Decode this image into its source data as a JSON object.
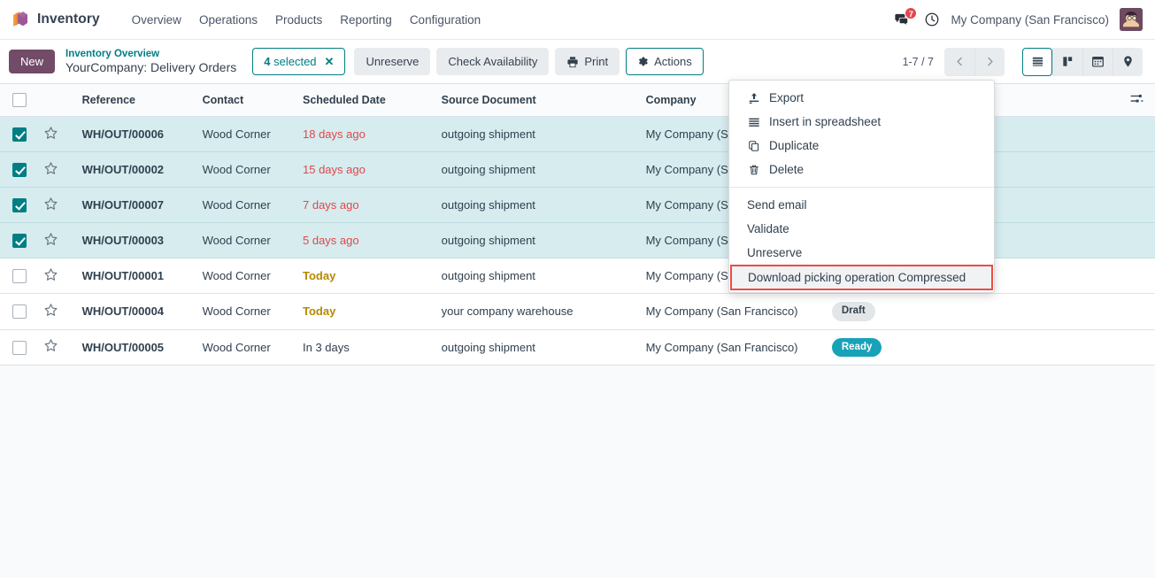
{
  "navbar": {
    "app_icon": "inventory-cube-icon",
    "app_name": "Inventory",
    "menu": [
      "Overview",
      "Operations",
      "Products",
      "Reporting",
      "Configuration"
    ],
    "messages_icon": "messages-icon",
    "messages_count": "7",
    "activity_icon": "clock-icon",
    "company": "My Company (San Francisco)",
    "avatar": "user-avatar"
  },
  "control_panel": {
    "new_label": "New",
    "breadcrumb_parent": "Inventory Overview",
    "breadcrumb_current": "YourCompany: Delivery Orders",
    "selection": {
      "count": "4",
      "label": "selected",
      "clear_icon": "close-icon"
    },
    "buttons": [
      {
        "label": "Unreserve",
        "style": "gray",
        "icon": ""
      },
      {
        "label": "Check Availability",
        "style": "gray",
        "icon": ""
      },
      {
        "label": "Print",
        "style": "gray",
        "icon": "printer-icon"
      }
    ],
    "actions_label": "Actions",
    "actions_icon": "gear-icon",
    "pager": {
      "range": "1-7 / 7",
      "prev_icon": "chevron-left-icon",
      "next_icon": "chevron-right-icon"
    },
    "views": [
      {
        "name": "list",
        "icon": "list-view-icon",
        "active": true
      },
      {
        "name": "kanban",
        "icon": "kanban-view-icon",
        "active": false
      },
      {
        "name": "calendar",
        "icon": "calendar-view-icon",
        "active": false
      },
      {
        "name": "map",
        "icon": "map-pin-view-icon",
        "active": false
      }
    ]
  },
  "actions_menu": {
    "group1": [
      {
        "label": "Export",
        "icon": "upload-icon"
      },
      {
        "label": "Insert in spreadsheet",
        "icon": "bars-icon"
      },
      {
        "label": "Duplicate",
        "icon": "copy-icon"
      },
      {
        "label": "Delete",
        "icon": "trash-icon"
      }
    ],
    "group2": [
      {
        "label": "Send email",
        "highlight": false
      },
      {
        "label": "Validate",
        "highlight": false
      },
      {
        "label": "Unreserve",
        "highlight": false
      },
      {
        "label": "Download picking operation Compressed",
        "highlight": true
      }
    ],
    "highlight_color": "#ec4b44"
  },
  "table": {
    "options_icon": "column-options-icon",
    "headers": [
      "",
      "",
      "Reference",
      "Contact",
      "Scheduled Date",
      "Source Document",
      "Company",
      "",
      ""
    ],
    "rows": [
      {
        "selected": true,
        "reference": "WH/OUT/00006",
        "contact": "Wood Corner",
        "date": "18 days ago",
        "date_style": "late",
        "source": "outgoing shipment",
        "company": "My Company (San Francisco)",
        "status": ""
      },
      {
        "selected": true,
        "reference": "WH/OUT/00002",
        "contact": "Wood Corner",
        "date": "15 days ago",
        "date_style": "late",
        "source": "outgoing shipment",
        "company": "My Company (San Francisco)",
        "status": ""
      },
      {
        "selected": true,
        "reference": "WH/OUT/00007",
        "contact": "Wood Corner",
        "date": "7 days ago",
        "date_style": "late",
        "source": "outgoing shipment",
        "company": "My Company (San Francisco)",
        "status": ""
      },
      {
        "selected": true,
        "reference": "WH/OUT/00003",
        "contact": "Wood Corner",
        "date": "5 days ago",
        "date_style": "late",
        "source": "outgoing shipment",
        "company": "My Company (San Francisco)",
        "status": ""
      },
      {
        "selected": false,
        "reference": "WH/OUT/00001",
        "contact": "Wood Corner",
        "date": "Today",
        "date_style": "today",
        "source": "outgoing shipment",
        "company": "My Company (San Francisco)",
        "status": ""
      },
      {
        "selected": false,
        "reference": "WH/OUT/00004",
        "contact": "Wood Corner",
        "date": "Today",
        "date_style": "today",
        "source": "your company warehouse",
        "company": "My Company (San Francisco)",
        "status": "Draft",
        "status_style": "draft"
      },
      {
        "selected": false,
        "reference": "WH/OUT/00005",
        "contact": "Wood Corner",
        "date": "In 3 days",
        "date_style": "normal",
        "source": "outgoing shipment",
        "company": "My Company (San Francisco)",
        "status": "Ready",
        "status_style": "ready"
      }
    ]
  },
  "colors": {
    "accent_teal": "#017e84",
    "brand_purple": "#714b67",
    "danger": "#e2474c",
    "warning": "#b58a00",
    "ready_badge": "#17a2b8"
  }
}
